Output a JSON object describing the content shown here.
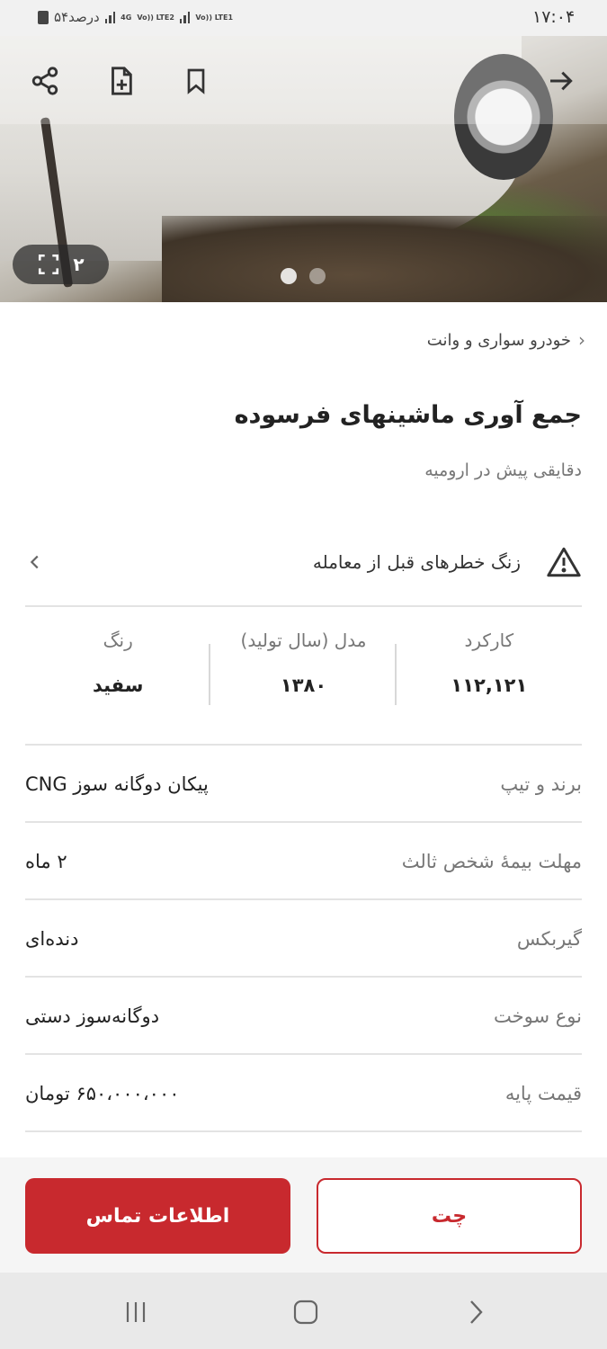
{
  "status_bar": {
    "time": "۱۷:۰۴",
    "battery_text": "۵۴درصد",
    "network_1": "Vo)) LTE1",
    "network_2": "Vo)) LTE2",
    "network_3": "4G"
  },
  "hero": {
    "image_counter": "۲",
    "dots": 2,
    "active_dot": 1
  },
  "breadcrumb": {
    "label": "خودرو سواری و وانت"
  },
  "ad": {
    "title": "جمع آوری ماشینهای فرسوده",
    "subtitle": "دقایقی پیش در ارومیه"
  },
  "warning": {
    "label": "زنگ خطرهای قبل از معامله"
  },
  "stats": [
    {
      "label": "کارکرد",
      "value": "۱۱۲,۱۲۱"
    },
    {
      "label": "مدل (سال تولید)",
      "value": "۱۳۸۰"
    },
    {
      "label": "رنگ",
      "value": "سفید"
    }
  ],
  "details": [
    {
      "label": "برند و تیپ",
      "value": "پیکان دوگانه سوز CNG"
    },
    {
      "label": "مهلت بیمهٔ شخص ثالث",
      "value": "۲ ماه"
    },
    {
      "label": "گیربکس",
      "value": "دنده‌ای"
    },
    {
      "label": "نوع سوخت",
      "value": "دوگانه‌سوز دستی"
    },
    {
      "label": "قیمت پایه",
      "value": "۶۵۰،۰۰۰،۰۰۰ تومان"
    }
  ],
  "actions": {
    "contact_label": "اطلاعات تماس",
    "chat_label": "چت"
  },
  "colors": {
    "accent": "#c8292e",
    "text": "#222222",
    "muted": "#777777"
  }
}
